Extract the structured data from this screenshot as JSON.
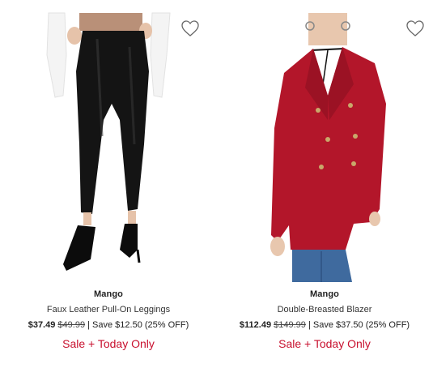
{
  "products": [
    {
      "brand": "Mango",
      "name": "Faux Leather Pull-On Leggings",
      "price_now": "$37.49",
      "price_was": "$49.99",
      "save_text": "| Save $12.50 (25% OFF)",
      "promo": "Sale + Today Only",
      "image_alt": "model-wearing-black-faux-leather-leggings",
      "favorite_icon": "heart-outline-icon"
    },
    {
      "brand": "Mango",
      "name": "Double-Breasted Blazer",
      "price_now": "$112.49",
      "price_was": "$149.99",
      "save_text": "| Save $37.50 (25% OFF)",
      "promo": "Sale + Today Only",
      "image_alt": "model-wearing-red-double-breasted-blazer",
      "favorite_icon": "heart-outline-icon"
    }
  ],
  "colors": {
    "promo_red": "#c8102e",
    "text_dark": "#1a1a1a",
    "blazer_red": "#b3162a",
    "leggings_black": "#111111"
  }
}
